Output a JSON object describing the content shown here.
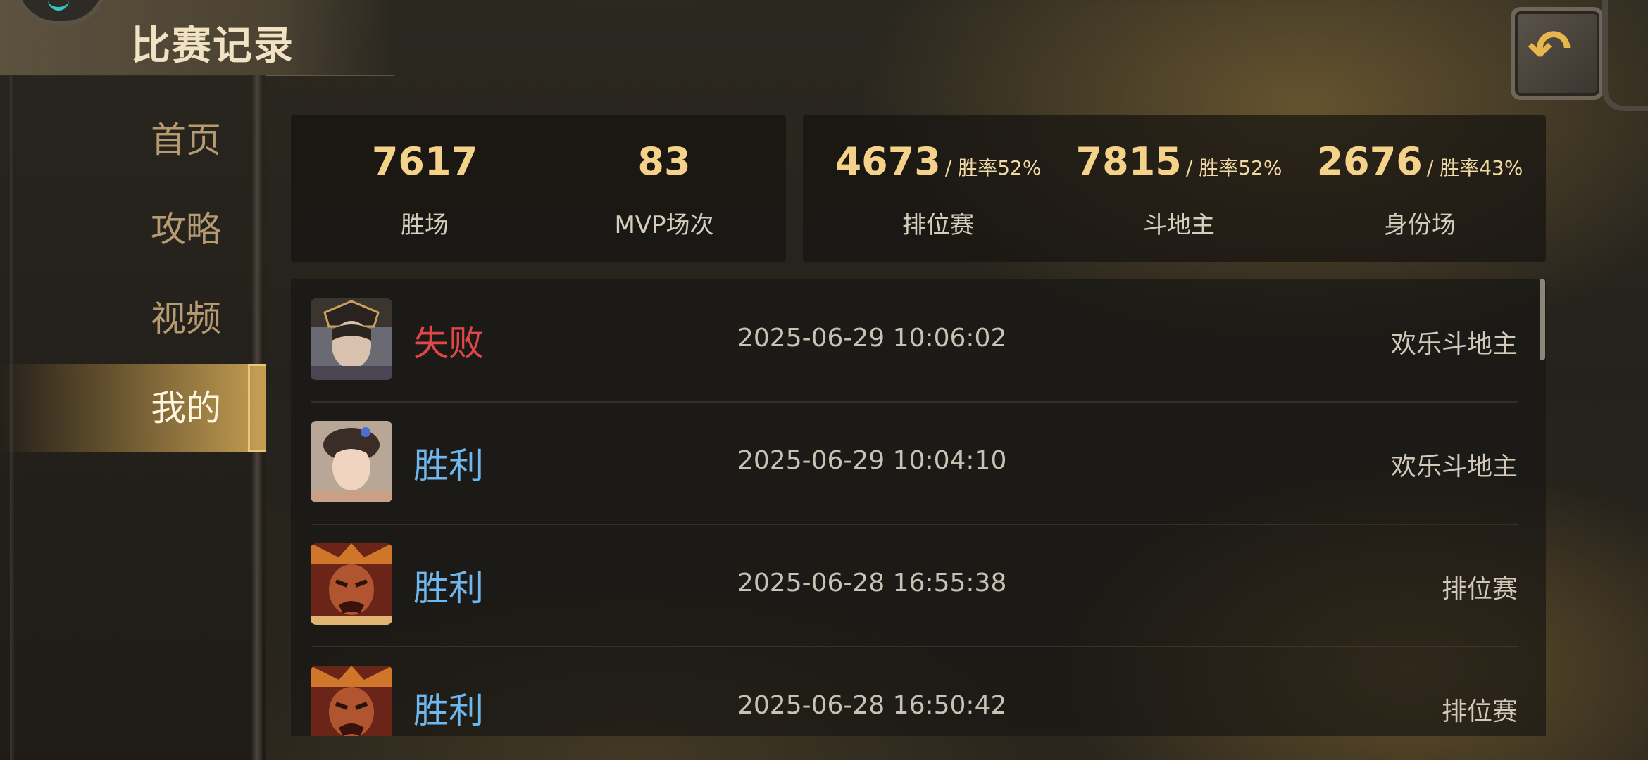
{
  "header": {
    "title": "比赛记录"
  },
  "sidebar": {
    "items": [
      {
        "label": "首页"
      },
      {
        "label": "攻略"
      },
      {
        "label": "视频"
      },
      {
        "label": "我的"
      }
    ],
    "active": "我的"
  },
  "stats_left": [
    {
      "value": "7617",
      "label": "胜场"
    },
    {
      "value": "83",
      "label": "MVP场次"
    }
  ],
  "stats_right": [
    {
      "value": "4673",
      "rate": "/ 胜率52%",
      "label": "排位赛"
    },
    {
      "value": "7815",
      "rate": "/ 胜率52%",
      "label": "斗地主"
    },
    {
      "value": "2676",
      "rate": "/ 胜率43%",
      "label": "身份场"
    }
  ],
  "matches": [
    {
      "result": "失败",
      "status": "lose",
      "time": "2025-06-29 10:06:02",
      "mode": "欢乐斗地主"
    },
    {
      "result": "胜利",
      "status": "win",
      "time": "2025-06-29 10:04:10",
      "mode": "欢乐斗地主"
    },
    {
      "result": "胜利",
      "status": "win",
      "time": "2025-06-28 16:55:38",
      "mode": "排位赛"
    },
    {
      "result": "胜利",
      "status": "win",
      "time": "2025-06-28 16:50:42",
      "mode": "排位赛"
    }
  ],
  "colors": {
    "win": "#6fb7ef",
    "lose": "#e0464a",
    "accent": "#f4d28a"
  }
}
